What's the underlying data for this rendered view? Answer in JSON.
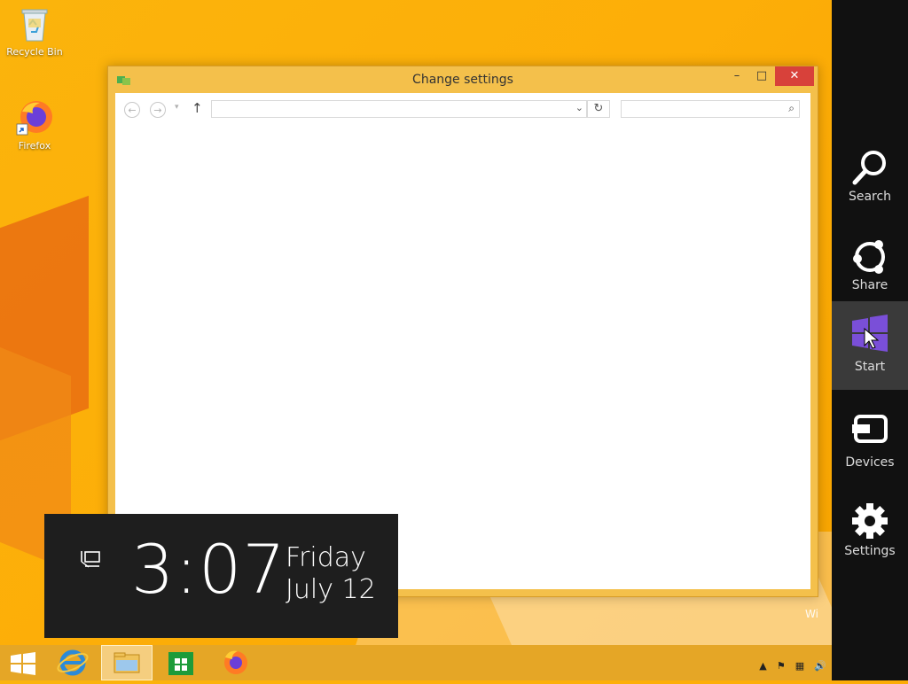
{
  "desktop": {
    "icons": [
      {
        "label": "Recycle Bin",
        "icon": "recycle-bin-icon"
      },
      {
        "label": "Firefox",
        "icon": "firefox-icon"
      }
    ]
  },
  "window": {
    "title": "Change settings",
    "controls": {
      "minimize": "–",
      "maximize": "□",
      "close": "✕"
    },
    "toolbar": {
      "back": "←",
      "forward": "→",
      "recent_dropdown": "▾",
      "up": "↑",
      "address_value": "",
      "address_dropdown": "⌄",
      "refresh": "↻",
      "search_value": "",
      "search_icon": "⌕"
    }
  },
  "charms": [
    {
      "label": "Search",
      "icon": "search-icon"
    },
    {
      "label": "Share",
      "icon": "share-icon"
    },
    {
      "label": "Start",
      "icon": "windows-logo-icon",
      "active": true
    },
    {
      "label": "Devices",
      "icon": "devices-icon"
    },
    {
      "label": "Settings",
      "icon": "gear-icon"
    }
  ],
  "clock": {
    "time": "3:07",
    "day": "Friday",
    "date": "July 12"
  },
  "taskbar": {
    "items": [
      "start",
      "internet-explorer",
      "file-explorer",
      "store",
      "firefox"
    ],
    "tray": [
      "▲",
      "⚑",
      "▦",
      "🔊"
    ]
  },
  "watermark": "Wi",
  "colors": {
    "accent": "#fbb40c",
    "charm_bg": "#111111",
    "charm_active": "#3a3a3a",
    "start_logo": "#7a4fd8",
    "close": "#d8413a"
  }
}
